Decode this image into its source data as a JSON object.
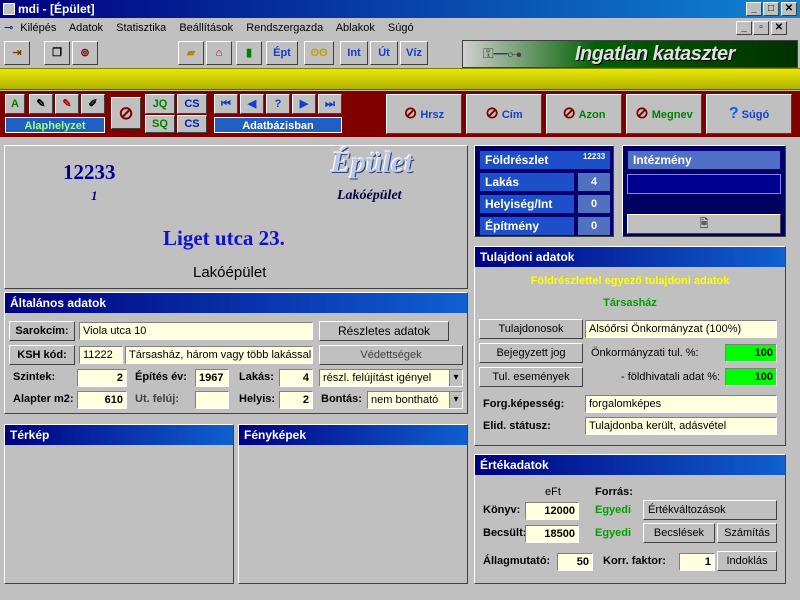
{
  "window": {
    "title": "mdi - [Épület]"
  },
  "menu": [
    "Kilépés",
    "Adatok",
    "Statisztika",
    "Beállítások",
    "Rendszergazda",
    "Ablakok",
    "Súgó"
  ],
  "toolbar": {
    "btn_ept": "Épt",
    "btn_int": "Int",
    "btn_ut": "Út",
    "btn_viz": "Víz",
    "logo_text": "Ingatlan kataszter"
  },
  "nav": {
    "alaphelyzet": "Alaphelyzet",
    "adatbazis": "Adatbázisban",
    "help_q": "?",
    "hrsz": "Hrsz",
    "cim": "Cím",
    "azon": "Azon",
    "megnev": "Megnev",
    "sugo": "Súgó"
  },
  "header": {
    "id": "12233",
    "sub": "1",
    "type_title": "Épület",
    "type_sub": "Lakóépület",
    "address": "Liget utca  23.",
    "use": "Lakóépület"
  },
  "stats": {
    "foldreszlet": "Földrészlet",
    "foldreszlet_val": "12233",
    "lakas": "Lakás",
    "lakas_val": "4",
    "helyiseg": "Helyiség/Int",
    "helyiseg_val": "0",
    "epitmeny": "Építmény",
    "epitmeny_val": "0",
    "intezmeny": "Intézmény"
  },
  "general": {
    "title": "Általános adatok",
    "sarokcim_lbl": "Sarokcím:",
    "sarokcim": "Viola utca 10",
    "reszletes": "Részletes adatok",
    "ksh_lbl": "KSH kód:",
    "ksh": "11222",
    "ksh_desc": "Társasház, három vagy több lakással",
    "vedettsegek": "Védettségek",
    "szintek_lbl": "Szintek:",
    "szintek": "2",
    "epites_lbl": "Építés év:",
    "epites": "1967",
    "lakas_lbl": "Lakás:",
    "lakas": "4",
    "allapot": "részl. felújítást igényel",
    "alapter_lbl": "Alapter m2:",
    "alapter": "610",
    "utfel_lbl": "Ut. felúj:",
    "utfel": "",
    "helyis_lbl": "Helyis:",
    "helyis": "2",
    "bontas_lbl": "Bontás:",
    "bontas": "nem bontható"
  },
  "terkep": "Térkép",
  "fenykepek": "Fényképek",
  "ownership": {
    "title": "Tulajdoni adatok",
    "line1": "Földrészlettel egyező tulajdoni adatok",
    "line2": "Társasház",
    "tulajdonosok": "Tulajdonosok",
    "tulaj_val": "Alsóőrsi Önkormányzat (100%)",
    "bejegyzett": "Bejegyzett jog",
    "onk_lbl": "Önkormányzati tul. %:",
    "onk_val": "100",
    "tulesem": "Tul. események",
    "fold_lbl": "- földhivatali adat %:",
    "fold_val": "100",
    "forg_lbl": "Forg.képesség:",
    "forg_val": "forgalomképes",
    "elid_lbl": "Elid. státusz:",
    "elid_val": "Tulajdonba került, adásvétel"
  },
  "value": {
    "title": "Értékadatok",
    "eft": "eFt",
    "forras": "Forrás:",
    "konyv_lbl": "Könyv:",
    "konyv": "12000",
    "konyv_src": "Egyedi",
    "becsult_lbl": "Becsült:",
    "becsult": "18500",
    "becsult_src": "Egyedi",
    "ertekvalt": "Értékváltozások",
    "becslesek": "Becslések",
    "szamitas": "Számítás",
    "allam_lbl": "Állagmutató:",
    "allam": "50",
    "korr_lbl": "Korr. faktor:",
    "korr": "1",
    "indoklas": "Indoklás"
  },
  "colors": {
    "accent": "#000080",
    "field": "#ffffe0",
    "highlight": "#00ff00",
    "toolbar_band": "#d8d800"
  }
}
